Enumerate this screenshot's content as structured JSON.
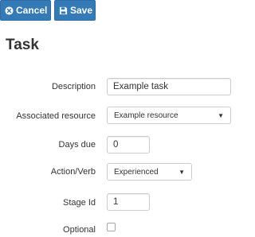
{
  "toolbar": {
    "cancel_label": "Cancel",
    "save_label": "Save"
  },
  "page": {
    "title": "Task"
  },
  "form": {
    "description": {
      "label": "Description",
      "value": "Example task"
    },
    "associated_resource": {
      "label": "Associated resource",
      "value": "Example resource"
    },
    "days_due": {
      "label": "Days due",
      "value": "0"
    },
    "action_verb": {
      "label": "Action/Verb",
      "value": "Experienced"
    },
    "stage_id": {
      "label": "Stage Id",
      "value": "1"
    },
    "optional": {
      "label": "Optional",
      "checked": false
    }
  },
  "icons": {
    "cancel": "circle-x-icon",
    "save": "floppy-disk-icon",
    "dropdown": "caret-down-icon"
  },
  "colors": {
    "primary": "#337ab7",
    "input_border": "#cccccc",
    "text": "#333333"
  }
}
